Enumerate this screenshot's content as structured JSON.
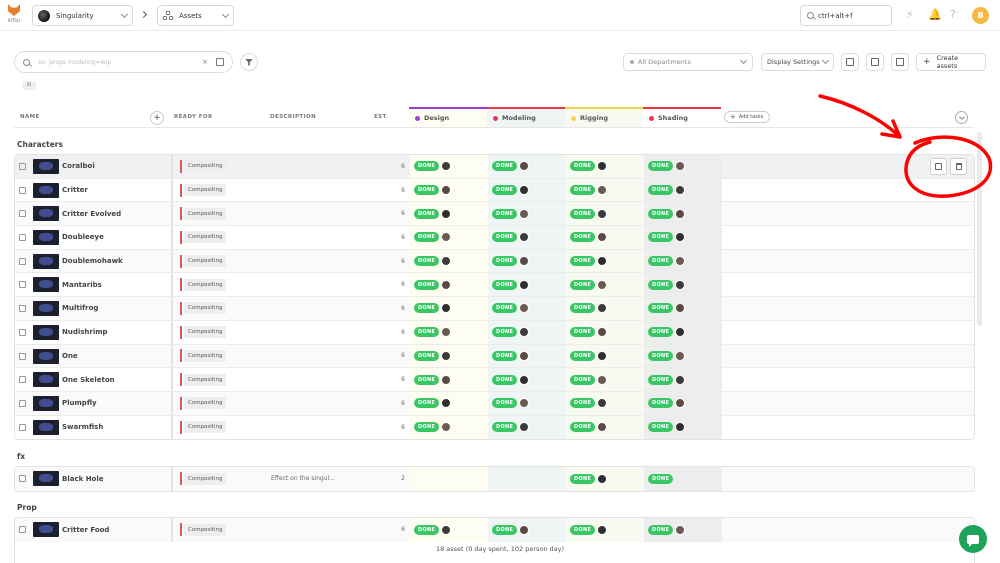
{
  "app": {
    "logo_text": "KITSU"
  },
  "topbar": {
    "production": "Singularity",
    "section": "Assets",
    "search_value": "ctrl+alt+f",
    "user_initial": "B"
  },
  "filters": {
    "search_placeholder": "ex: props modeling=wip",
    "clear_label": "×",
    "chip_label": "ID",
    "department": "All Departments",
    "display_settings": "Display Settings",
    "create_label": "Create assets"
  },
  "table": {
    "headers": {
      "name": "NAME",
      "ready_for": "READY FOR",
      "description": "DESCRIPTION",
      "estimation": "EST."
    },
    "add_column": "+",
    "add_tasks": "Add tasks",
    "task_types": [
      {
        "name": "Design",
        "color": "#9b3fd1"
      },
      {
        "name": "Modeling",
        "color": "#e8384f"
      },
      {
        "name": "Rigging",
        "color": "#f2d64a"
      },
      {
        "name": "Shading",
        "color": "#e8384f"
      }
    ],
    "status_label": "DONE",
    "groups": [
      {
        "title": "Characters",
        "rows": [
          {
            "name": "Coralboi",
            "ready": "Compositing",
            "description": "",
            "est": "6",
            "tasks": [
              true,
              true,
              true,
              true
            ]
          },
          {
            "name": "Critter",
            "ready": "Compositing",
            "description": "",
            "est": "6",
            "tasks": [
              true,
              true,
              true,
              true
            ]
          },
          {
            "name": "Critter Evolved",
            "ready": "Compositing",
            "description": "",
            "est": "6",
            "tasks": [
              true,
              true,
              true,
              true
            ]
          },
          {
            "name": "Doubleeye",
            "ready": "Compositing",
            "description": "",
            "est": "6",
            "tasks": [
              true,
              true,
              true,
              true
            ]
          },
          {
            "name": "Doublemohawk",
            "ready": "Compositing",
            "description": "",
            "est": "6",
            "tasks": [
              true,
              true,
              true,
              true
            ]
          },
          {
            "name": "Mantaribs",
            "ready": "Compositing",
            "description": "",
            "est": "6",
            "tasks": [
              true,
              true,
              true,
              true
            ]
          },
          {
            "name": "Multifrog",
            "ready": "Compositing",
            "description": "",
            "est": "6",
            "tasks": [
              true,
              true,
              true,
              true
            ]
          },
          {
            "name": "Nudishrimp",
            "ready": "Compositing",
            "description": "",
            "est": "6",
            "tasks": [
              true,
              true,
              true,
              true
            ]
          },
          {
            "name": "One",
            "ready": "Compositing",
            "description": "",
            "est": "6",
            "tasks": [
              true,
              true,
              true,
              true
            ]
          },
          {
            "name": "One Skeleton",
            "ready": "Compositing",
            "description": "",
            "est": "6",
            "tasks": [
              true,
              true,
              true,
              true
            ]
          },
          {
            "name": "Plumpfly",
            "ready": "Compositing",
            "description": "",
            "est": "6",
            "tasks": [
              true,
              true,
              true,
              true
            ]
          },
          {
            "name": "Swarmfish",
            "ready": "Compositing",
            "description": "",
            "est": "6",
            "tasks": [
              true,
              true,
              true,
              true
            ]
          }
        ]
      },
      {
        "title": "fx",
        "rows": [
          {
            "name": "Black Hole",
            "ready": "Compositing",
            "description": "Effect on the singul...",
            "est": "2",
            "tasks": [
              false,
              false,
              true,
              true
            ],
            "no_avatar_last": true
          }
        ]
      },
      {
        "title": "Prop",
        "rows": [
          {
            "name": "Critter Food",
            "ready": "Compositing",
            "description": "",
            "est": "6",
            "tasks": [
              true,
              true,
              true,
              true
            ]
          }
        ]
      }
    ]
  },
  "footer": {
    "summary": "18 asset (0 day spent, 102 person day)"
  },
  "colors": {
    "done": "#39c665",
    "accent": "#f3b944",
    "annotation": "#ff0000"
  }
}
